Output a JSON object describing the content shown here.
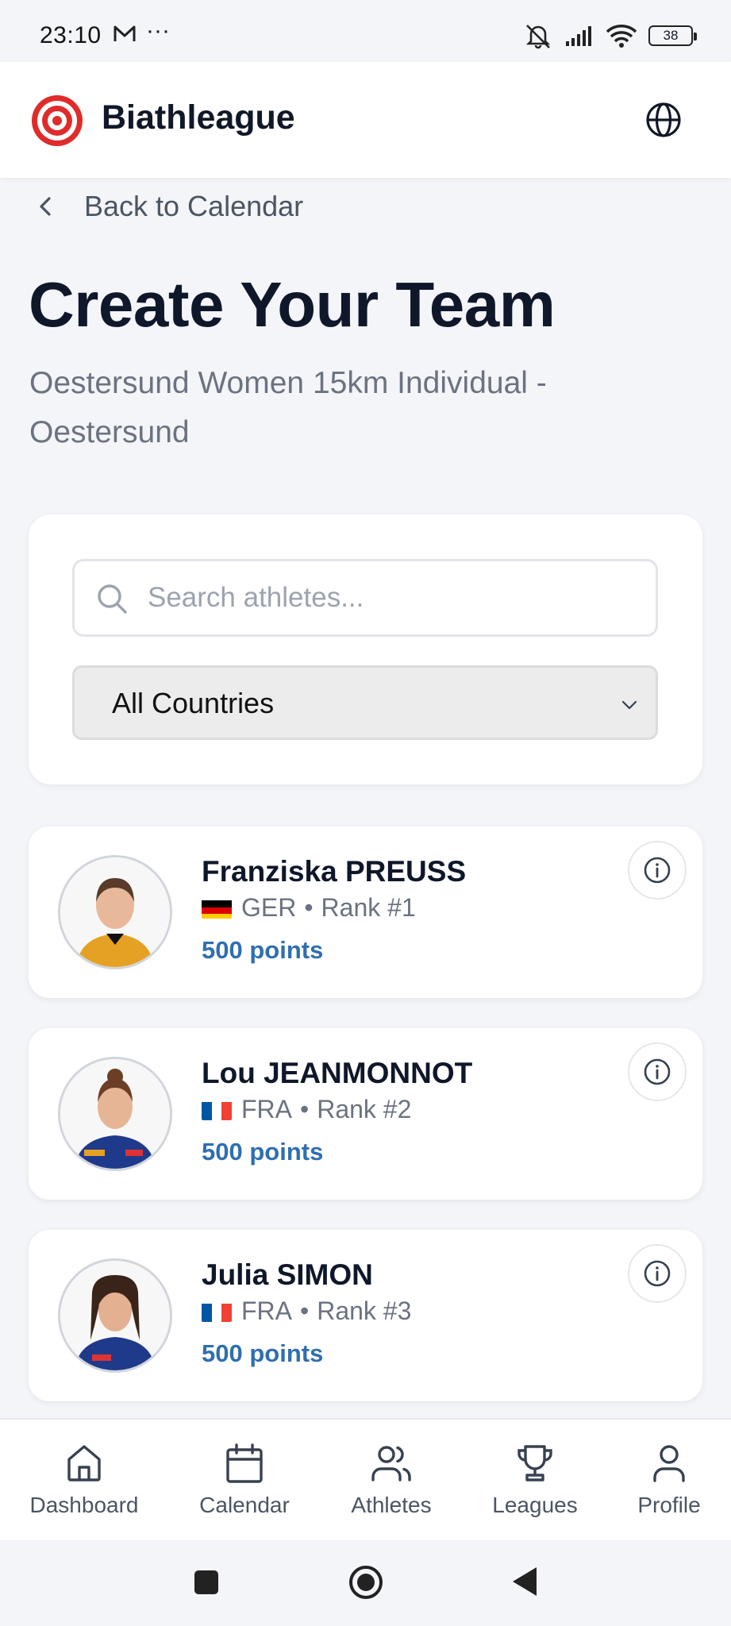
{
  "status_bar": {
    "time": "23:10",
    "extra": "···",
    "battery": "38"
  },
  "header": {
    "brand": "Biathleague"
  },
  "back_link": {
    "label": "Back to Calendar"
  },
  "page": {
    "title": "Create Your Team",
    "subtitle": "Oestersund Women 15km Individual - Oestersund"
  },
  "filters": {
    "search_placeholder": "Search athletes...",
    "search_value": "",
    "country_selected": "All Countries"
  },
  "athletes": [
    {
      "name": "Franziska PREUSS",
      "country": "GER",
      "rank": "Rank #1",
      "points": "500 points",
      "flag": "ger",
      "jersey_color": "#e5a124"
    },
    {
      "name": "Lou JEANMONNOT",
      "country": "FRA",
      "rank": "Rank #2",
      "points": "500 points",
      "flag": "fra",
      "jersey_color": "#1f3a8a"
    },
    {
      "name": "Julia SIMON",
      "country": "FRA",
      "rank": "Rank #3",
      "points": "500 points",
      "flag": "fra",
      "jersey_color": "#1f3a8a"
    }
  ],
  "meta_separator": "•",
  "bottom_nav": {
    "items": [
      {
        "label": "Dashboard",
        "icon": "home-icon"
      },
      {
        "label": "Calendar",
        "icon": "calendar-icon"
      },
      {
        "label": "Athletes",
        "icon": "users-icon"
      },
      {
        "label": "Leagues",
        "icon": "trophy-icon"
      },
      {
        "label": "Profile",
        "icon": "user-icon"
      }
    ]
  },
  "colors": {
    "accent": "#2f6fb0",
    "brand_red": "#e02b2b",
    "background": "#f4f5f9"
  }
}
